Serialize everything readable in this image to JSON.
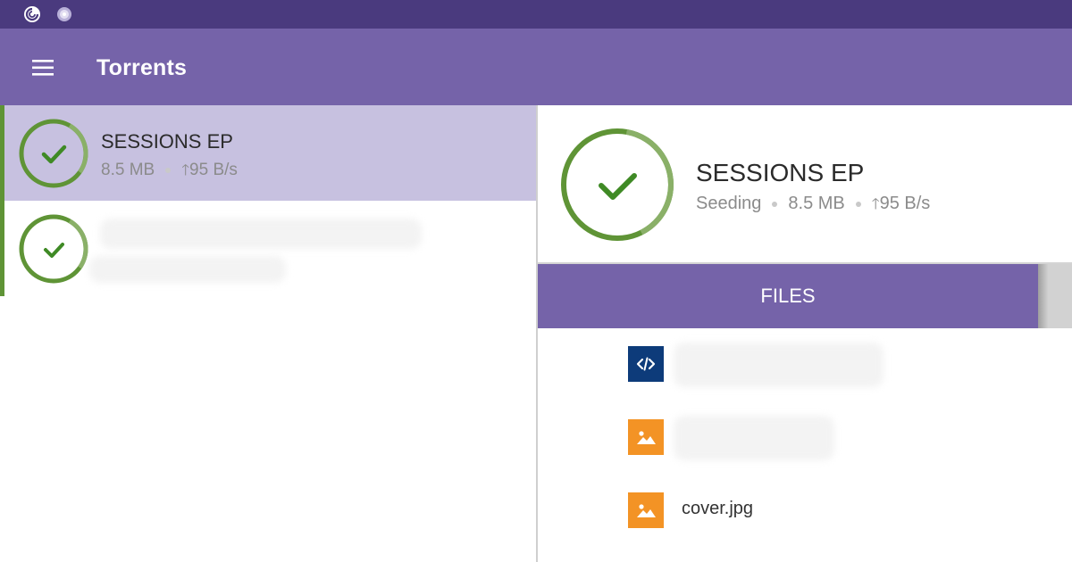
{
  "colors": {
    "status_bar": "#4a3a7e",
    "app_bar": "#7563a9",
    "selected_row": "#c7c1e0",
    "progress_green": "#5f9436",
    "code_icon_bg": "#0d3b7a",
    "image_icon_bg": "#f39325"
  },
  "status_bar": {
    "icons": [
      "tixati-app-icon",
      "spinner-app-icon"
    ]
  },
  "app_bar": {
    "menu_icon": "hamburger-menu-icon",
    "title": "Torrents"
  },
  "torrent_list": [
    {
      "name": "SESSIONS EP",
      "size": "8.5 MB",
      "upload_rate": "95 B/s",
      "status_icon": "check-icon",
      "progress": 1.0,
      "selected": true
    },
    {
      "status_icon": "check-icon",
      "progress": 1.0,
      "selected": false
    }
  ],
  "detail": {
    "name": "SESSIONS EP",
    "state": "Seeding",
    "size": "8.5 MB",
    "upload_rate": "95 B/s",
    "status_icon": "check-icon",
    "progress": 1.0
  },
  "tabs": {
    "files_label": "FILES"
  },
  "files": [
    {
      "icon": "code-file-icon"
    },
    {
      "icon": "image-file-icon"
    },
    {
      "icon": "image-file-icon",
      "name": "cover.jpg"
    }
  ]
}
